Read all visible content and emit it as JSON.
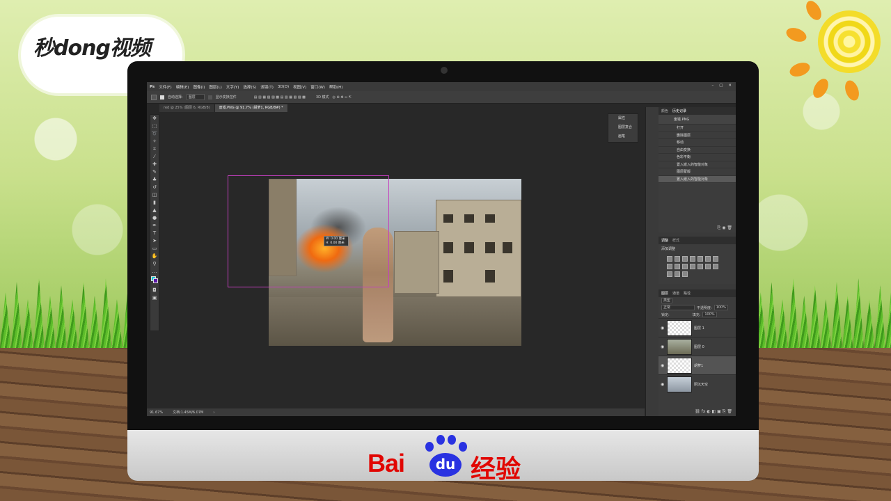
{
  "brand": {
    "watermark": "秒dong视频",
    "footer_baidu": "Bai",
    "footer_du": "du",
    "footer_jingyan": "经验"
  },
  "menu": {
    "logo": "Ps",
    "items": [
      "文件(F)",
      "编辑(E)",
      "图像(I)",
      "图层(L)",
      "文字(Y)",
      "选择(S)",
      "滤镜(T)",
      "3D(D)",
      "视图(V)",
      "窗口(W)",
      "帮助(H)"
    ]
  },
  "options": {
    "auto_select_label": "自动选择:",
    "auto_select_value": "图层",
    "show_transform": "显示变换控件",
    "mode_3d": "3D 模式"
  },
  "tabs": [
    {
      "label": "red @ 25% (图层 6, RGB/8)"
    },
    {
      "label": "废墟.PNG @ 91.7% (胡萝1, RGB/8#) *"
    }
  ],
  "canvas": {
    "tooltip_line1": "W: 0.00 厘米",
    "tooltip_line2": "H: 0.00 厘米"
  },
  "status": {
    "zoom": "91.67%",
    "doc": "文档:1.45M/6.07M"
  },
  "float_panel": {
    "items": [
      "属性",
      "图层复合",
      "画笔"
    ]
  },
  "history_panel": {
    "tabs": [
      "颜色",
      "历史记录"
    ],
    "snapshot": "废墟.PNG",
    "items": [
      "打开",
      "删除图层",
      "移动",
      "自由变换",
      "色彩平衡",
      "置入嵌入的智能对象",
      "图层蒙版",
      "置入嵌入的智能对象"
    ],
    "selected_index": 7
  },
  "adjustments_panel": {
    "tabs": [
      "调整",
      "样式"
    ],
    "title": "添加调整"
  },
  "layers_panel": {
    "tabs": [
      "图层",
      "通道",
      "路径"
    ],
    "kind": "类型",
    "blend": "正常",
    "opacity_label": "不透明度:",
    "opacity": "100%",
    "lock_label": "锁定:",
    "fill_label": "填充:",
    "fill": "100%",
    "layers": [
      {
        "name": "图层 1",
        "selected": false
      },
      {
        "name": "图层 0",
        "selected": false
      },
      {
        "name": "胡萝1",
        "selected": true
      },
      {
        "name": "阴沉天空",
        "selected": false
      }
    ]
  },
  "colors": {
    "foreground": "#19c6d8",
    "background": "#5b16a8",
    "selection": "#c43fbf"
  }
}
